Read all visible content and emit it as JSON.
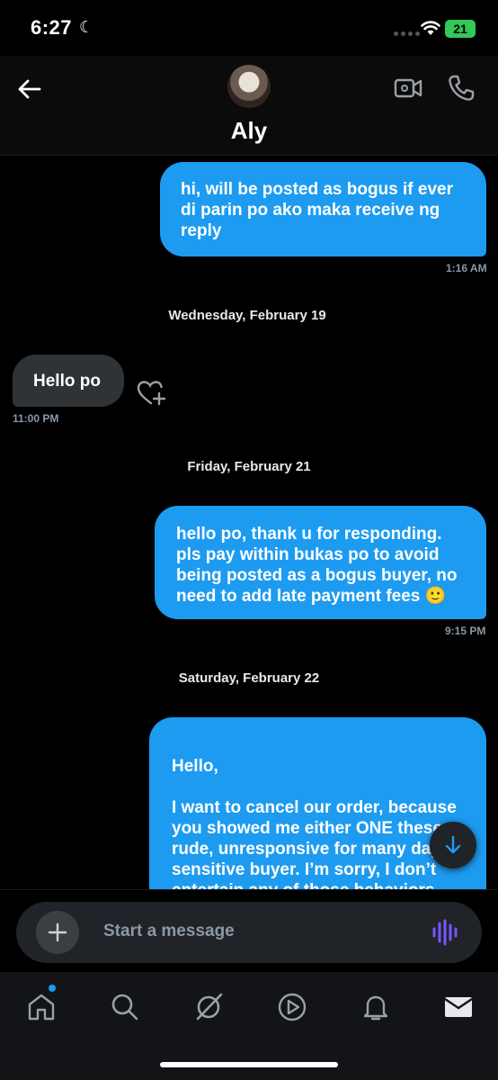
{
  "status_bar": {
    "time": "6:27",
    "battery": "21"
  },
  "header": {
    "contact_name": "Aly"
  },
  "messages": [
    {
      "text": "hi, will be posted as bogus if ever di parin po ako maka receive ng reply",
      "time": "1:16 AM"
    },
    {
      "text": "Hello po",
      "time": "11:00 PM"
    },
    {
      "text": "hello po, thank u for responding. pls pay within bukas po to avoid being posted as a bogus buyer, no need to add late payment fees 🙂",
      "time": "9:15 PM"
    },
    {
      "text": "Hello,\n\nI want to cancel our order, because you showed me either ONE these: rude, unresponsive for many days, sensitive buyer. I’m sorry, I don’t entertain any of those behaviors. The cancellation"
    }
  ],
  "dates": [
    "Wednesday, February 19",
    "Friday, February 21",
    "Saturday, February 22"
  ],
  "composer": {
    "placeholder": "Start a message"
  },
  "colors": {
    "accent": "#1d9bf0",
    "incoming": "#2f3336",
    "voice": "#7856ff"
  },
  "nav_icons": [
    "home-icon",
    "search-icon",
    "grok-icon",
    "video-icon",
    "notifications-icon",
    "messages-icon"
  ]
}
